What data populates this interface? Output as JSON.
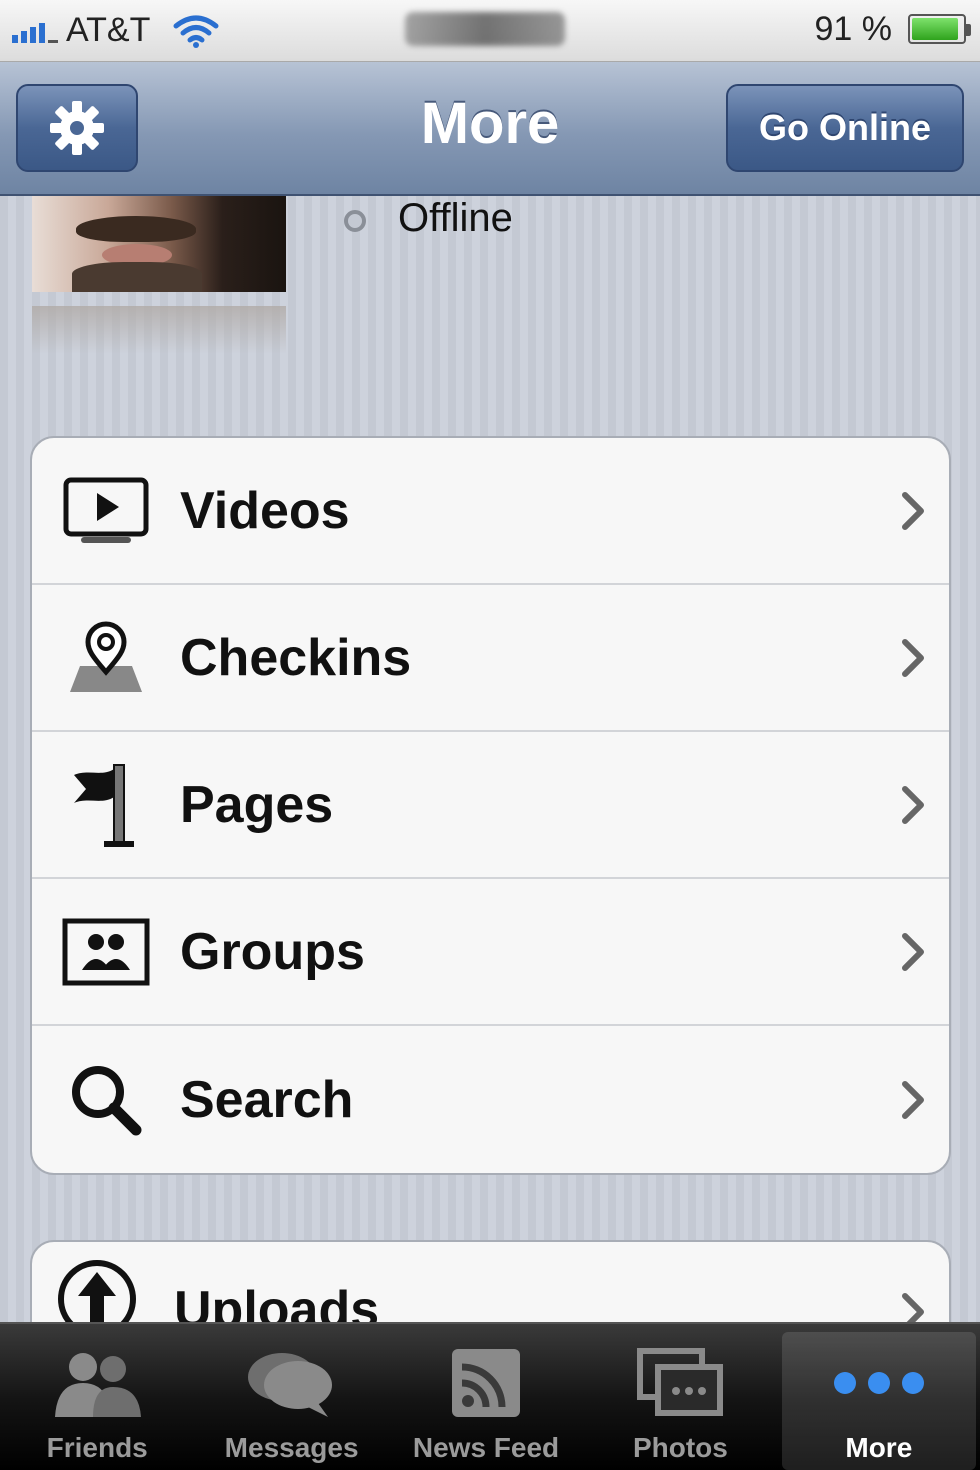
{
  "status_bar": {
    "carrier": "AT&T",
    "battery_percent": "91 %",
    "battery_level": 0.91
  },
  "nav": {
    "title": "More",
    "go_online_label": "Go Online"
  },
  "profile": {
    "status": "Offline"
  },
  "menu": {
    "items": [
      {
        "label": "Videos",
        "icon": "video-icon"
      },
      {
        "label": "Checkins",
        "icon": "map-pin-icon"
      },
      {
        "label": "Pages",
        "icon": "flag-icon"
      },
      {
        "label": "Groups",
        "icon": "group-icon"
      },
      {
        "label": "Search",
        "icon": "search-icon"
      }
    ],
    "secondary": [
      {
        "label": "Uploads",
        "icon": "upload-icon"
      }
    ]
  },
  "tabs": [
    {
      "label": "Friends",
      "icon": "friends-icon"
    },
    {
      "label": "Messages",
      "icon": "messages-icon"
    },
    {
      "label": "News Feed",
      "icon": "news-feed-icon"
    },
    {
      "label": "Photos",
      "icon": "photos-icon"
    },
    {
      "label": "More",
      "icon": "more-icon",
      "active": true
    }
  ],
  "colors": {
    "accent": "#4a6795",
    "active_tab_dots": "#3a8ef0"
  }
}
